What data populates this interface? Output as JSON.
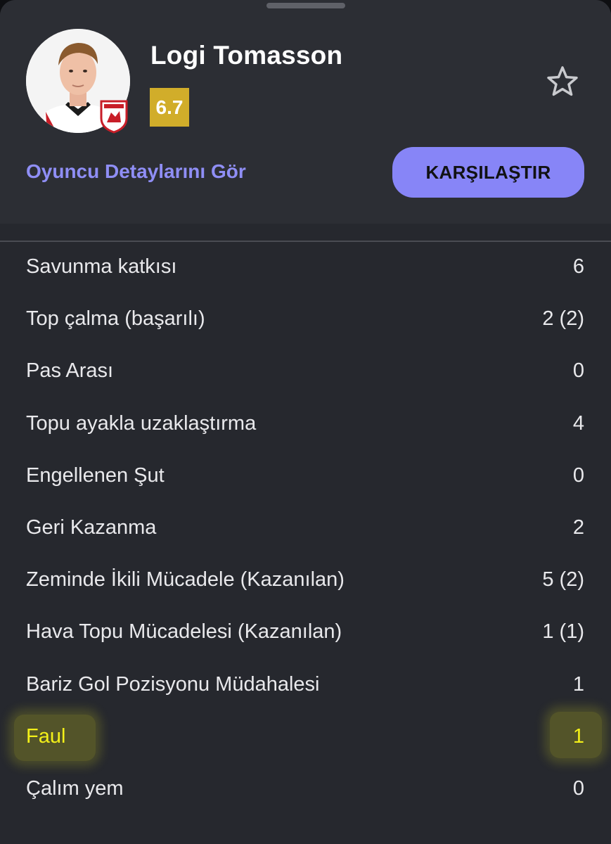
{
  "player": {
    "name": "Logi Tomasson",
    "rating": "6.7"
  },
  "actions": {
    "details_link": "Oyuncu Detaylarını Gör",
    "compare_button": "KARŞILAŞTIR"
  },
  "icons": {
    "favorite": "star-outline-icon",
    "club_badge": "club-badge-icon"
  },
  "colors": {
    "rating_badge": "#d1ad2a",
    "accent": "#8785f7",
    "highlight": "#f3f019",
    "background": "#26282e"
  },
  "stats": [
    {
      "label": "Savunma katkısı",
      "value": "6"
    },
    {
      "label": "Top çalma (başarılı)",
      "value": "2 (2)"
    },
    {
      "label": "Pas Arası",
      "value": "0"
    },
    {
      "label": "Topu ayakla uzaklaştırma",
      "value": "4"
    },
    {
      "label": "Engellenen Şut",
      "value": "0"
    },
    {
      "label": "Geri Kazanma",
      "value": "2"
    },
    {
      "label": "Zeminde İkili Mücadele (Kazanılan)",
      "value": "5 (2)"
    },
    {
      "label": "Hava Topu Mücadelesi (Kazanılan)",
      "value": "1 (1)"
    },
    {
      "label": "Bariz Gol Pozisyonu Müdahalesi",
      "value": "1"
    },
    {
      "label": "Faul",
      "value": "1",
      "highlighted": true
    },
    {
      "label": "Çalım yem",
      "value": "0"
    }
  ]
}
